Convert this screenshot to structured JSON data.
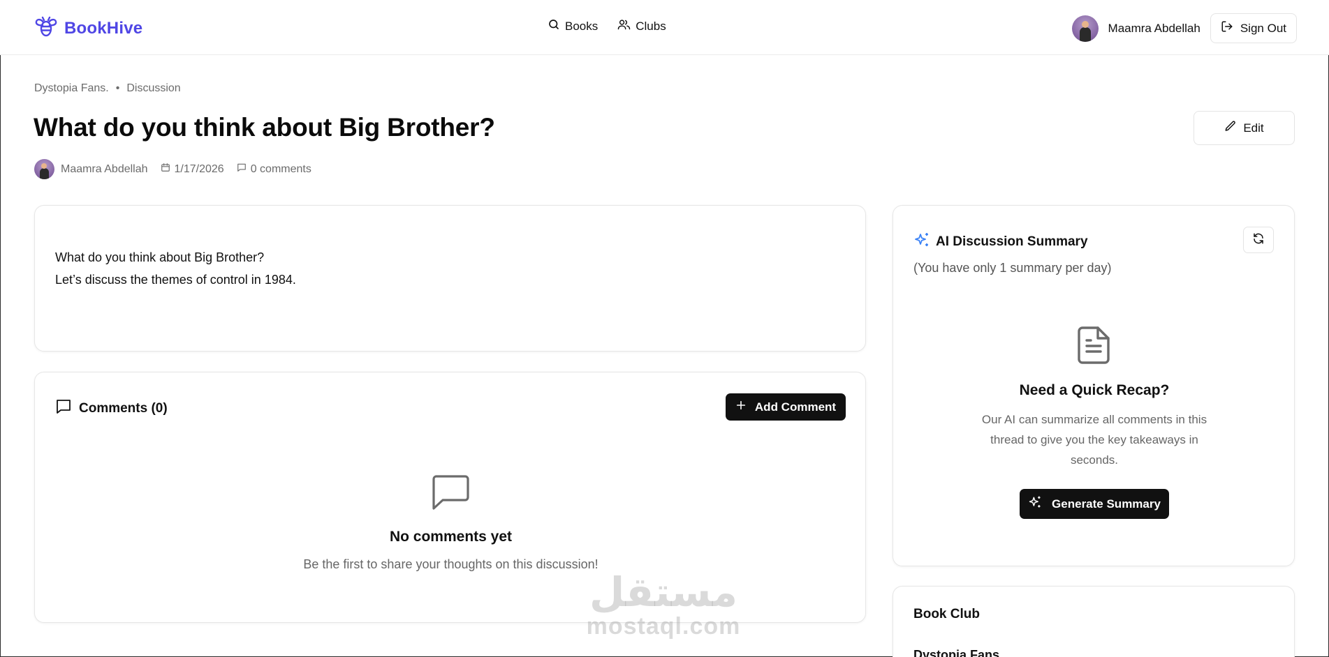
{
  "app": {
    "name": "BookHive",
    "brand_color": "#4f46e5"
  },
  "nav": {
    "items": [
      {
        "label": "Books",
        "icon": "search-icon"
      },
      {
        "label": "Clubs",
        "icon": "users-icon"
      }
    ]
  },
  "user": {
    "name": "Maamra Abdellah",
    "signout_label": "Sign Out"
  },
  "breadcrumb": {
    "club": "Dystopia Fans.",
    "separator": "•",
    "section": "Discussion"
  },
  "discussion": {
    "title": "What do you think about Big Brother?",
    "author": "Maamra Abdellah",
    "date": "1/17/2026",
    "comments_count": "0 comments",
    "edit_label": "Edit",
    "body_line1": "What do you think about Big Brother?",
    "body_line2": "Let’s discuss the themes of control in 1984."
  },
  "comments": {
    "title": "Comments (0)",
    "add_label": "Add Comment",
    "empty_title": "No comments yet",
    "empty_sub": "Be the first to share your thoughts on this discussion!"
  },
  "ai_summary": {
    "title": "AI Discussion Summary",
    "note": "(You have only 1 summary per day)",
    "recap_title": "Need a Quick Recap?",
    "recap_desc": "Our AI can summarize all comments in this thread to give you the key takeaways in seconds.",
    "button_label": "Generate Summary"
  },
  "book_club": {
    "heading": "Book Club",
    "name": "Dystopia Fans"
  },
  "watermark": {
    "arabic": "مستقل",
    "latin": "mostaql.com"
  },
  "colors": {
    "accent": "#4f46e5",
    "dark_button": "#111111",
    "muted_text": "#6b6b6b",
    "sparkle_blue": "#3b82f6"
  }
}
